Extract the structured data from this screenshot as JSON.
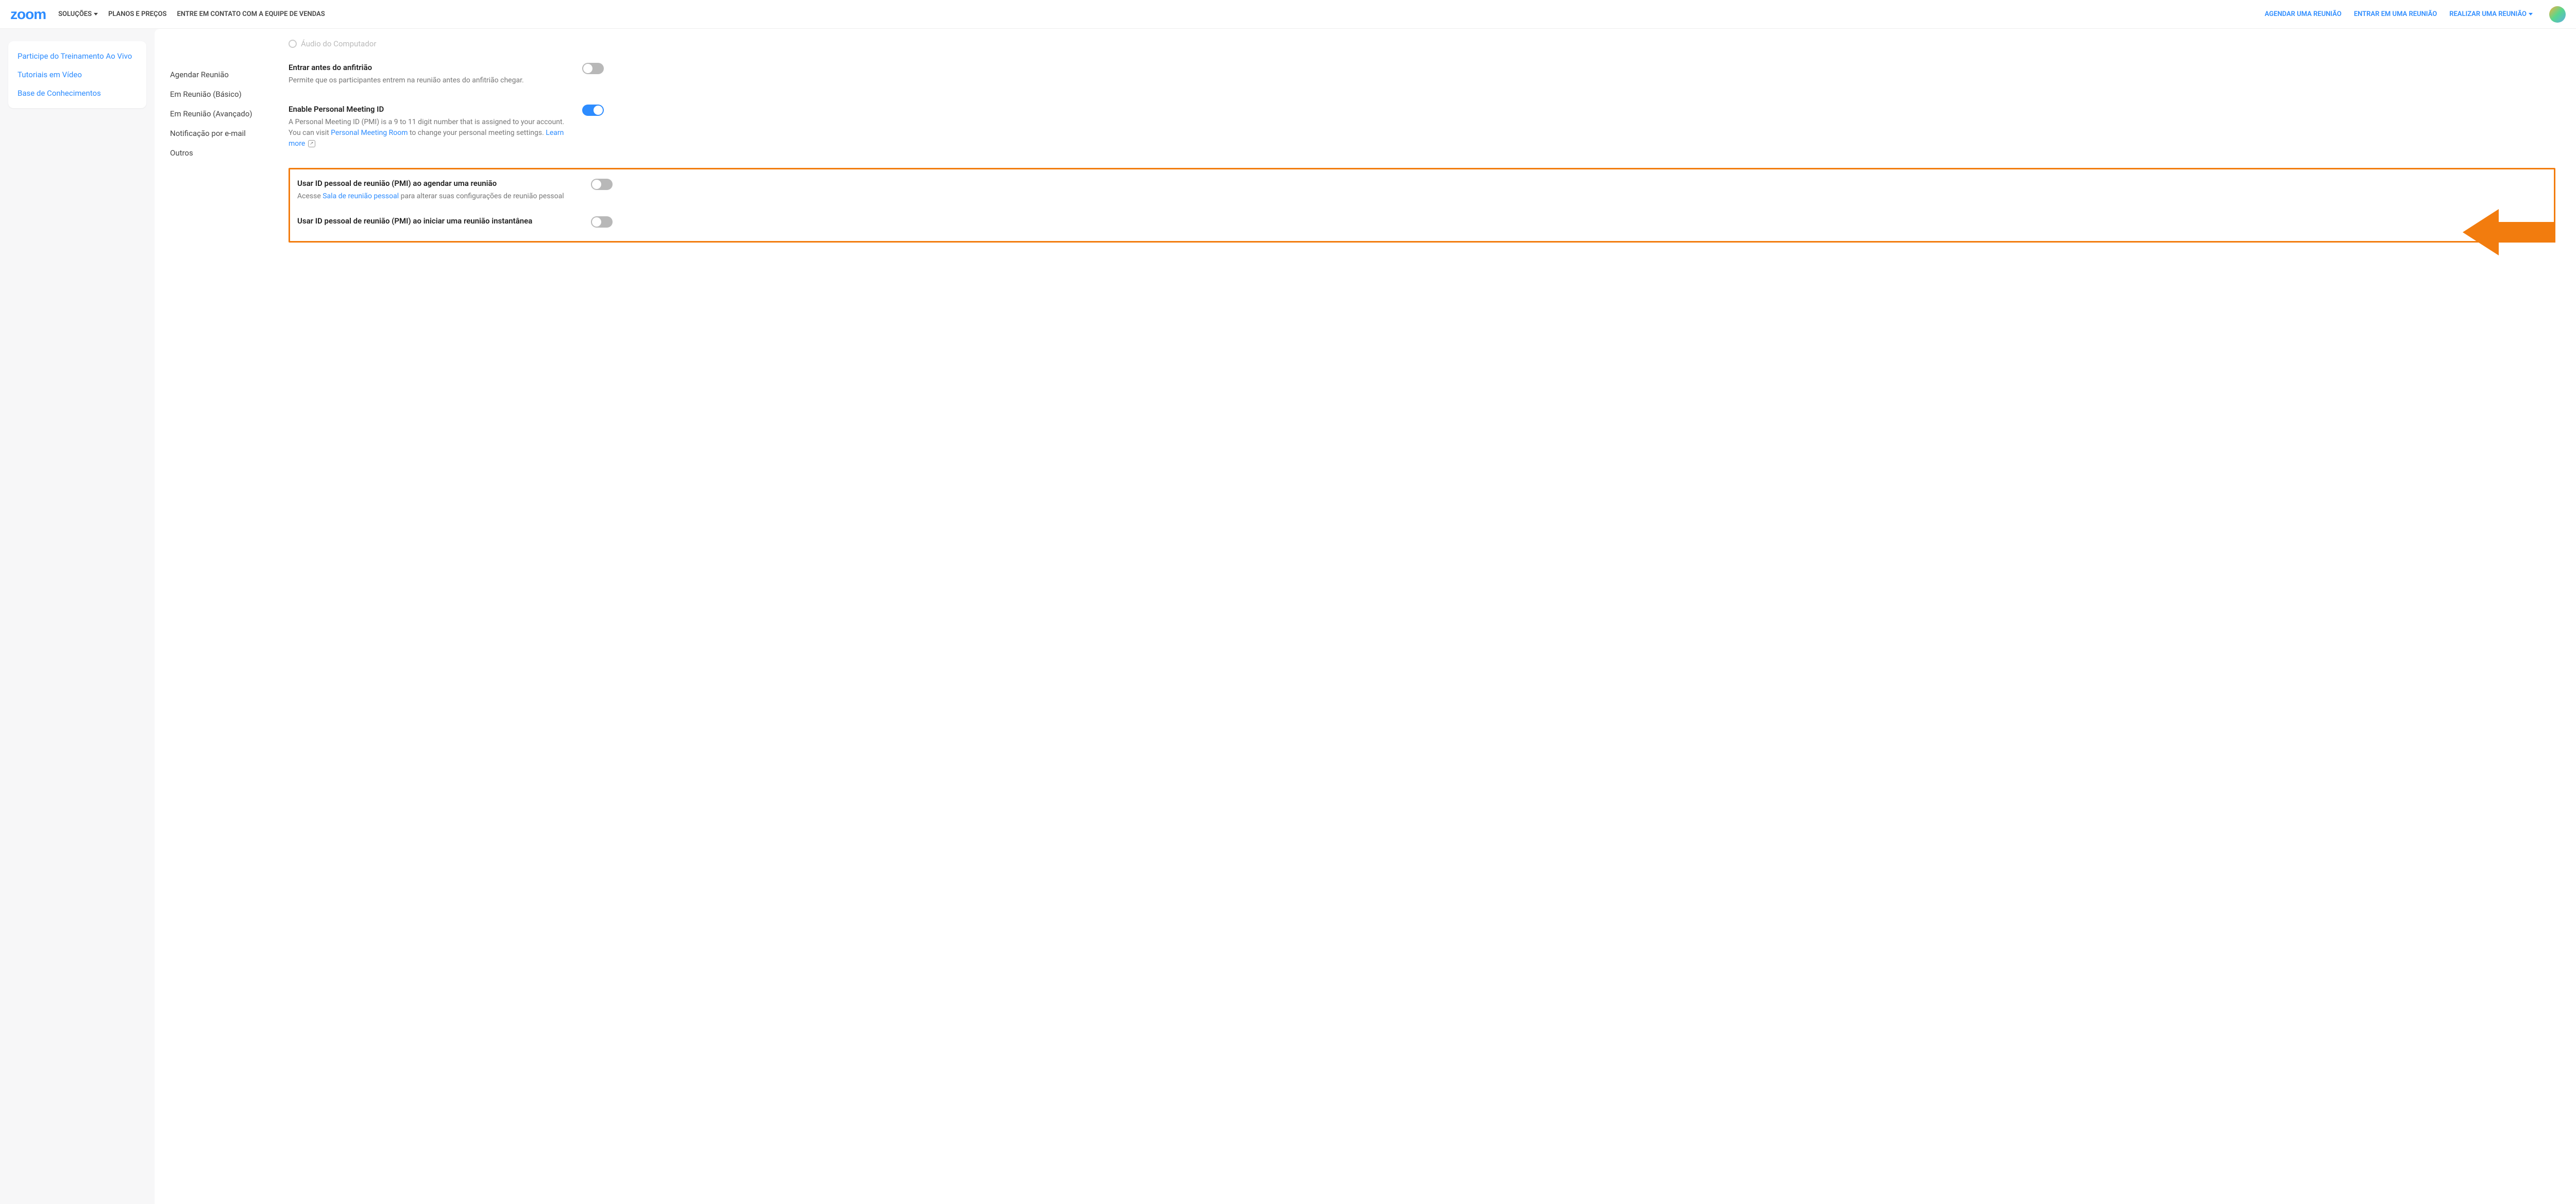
{
  "header": {
    "logo": "zoom",
    "nav_left": {
      "solutions": "SOLUÇÕES",
      "plans": "PLANOS E PREÇOS",
      "contact": "ENTRE EM CONTATO COM A EQUIPE DE VENDAS"
    },
    "nav_right": {
      "schedule": "AGENDAR UMA REUNIÃO",
      "join": "ENTRAR EM UMA REUNIÃO",
      "host": "REALIZAR UMA REUNIÃO"
    }
  },
  "sidebar": {
    "training": "Participe do Treinamento Ao Vivo",
    "tutorials": "Tutoriais em Vídeo",
    "kb": "Base de Conhecimentos"
  },
  "settings_nav": {
    "schedule": "Agendar Reunião",
    "in_basic": "Em Reunião (Básico)",
    "in_adv": "Em Reunião (Avançado)",
    "email": "Notificação por e-mail",
    "other": "Outros"
  },
  "top_partial": {
    "radio_label": "Áudio do Computador"
  },
  "settings": {
    "join_before": {
      "title": "Entrar antes do anfitrião",
      "desc": "Permite que os participantes entrem na reunião antes do anfitrião chegar."
    },
    "pmi": {
      "title": "Enable Personal Meeting ID",
      "desc_pre": "A Personal Meeting ID (PMI) is a 9 to 11 digit number that is assigned to your account. You can visit ",
      "link1": "Personal Meeting Room",
      "desc_mid": " to change your personal meeting settings. ",
      "link2": "Learn more"
    },
    "use_pmi_schedule": {
      "title": "Usar ID pessoal de reunião (PMI) ao agendar uma reunião",
      "desc_pre": "Acesse ",
      "link": "Sala de reunião pessoal",
      "desc_post": " para alterar suas configurações de reunião pessoal"
    },
    "use_pmi_instant": {
      "title": "Usar ID pessoal de reunião (PMI) ao iniciar uma reunião instantânea"
    }
  }
}
